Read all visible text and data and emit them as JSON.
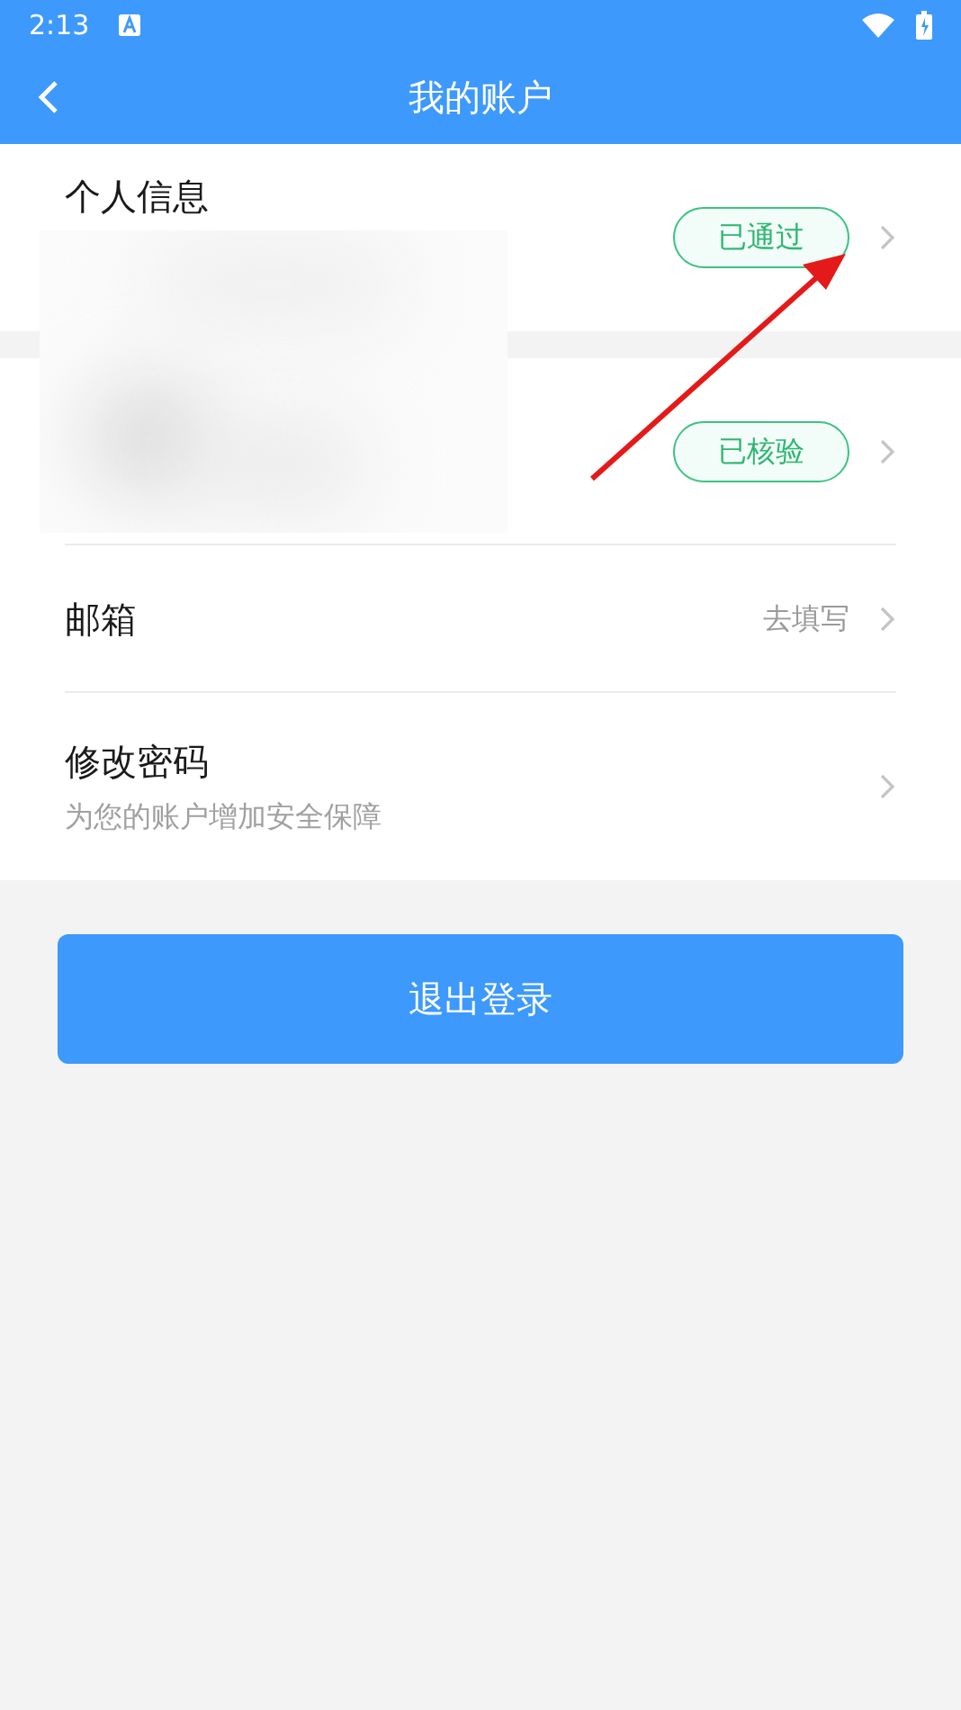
{
  "status_bar": {
    "time": "2:13"
  },
  "header": {
    "title": "我的账户"
  },
  "sections": [
    {
      "rows": [
        {
          "kind": "badge",
          "label": "个人信息",
          "badge": "已通过"
        }
      ]
    },
    {
      "rows": [
        {
          "kind": "badge",
          "badge": "已核验"
        },
        {
          "kind": "value",
          "label": "邮箱",
          "value": "去填写"
        },
        {
          "kind": "subtitle",
          "label": "修改密码",
          "subtitle": "为您的账户增加安全保障"
        }
      ]
    }
  ],
  "logout_button": "退出登录"
}
